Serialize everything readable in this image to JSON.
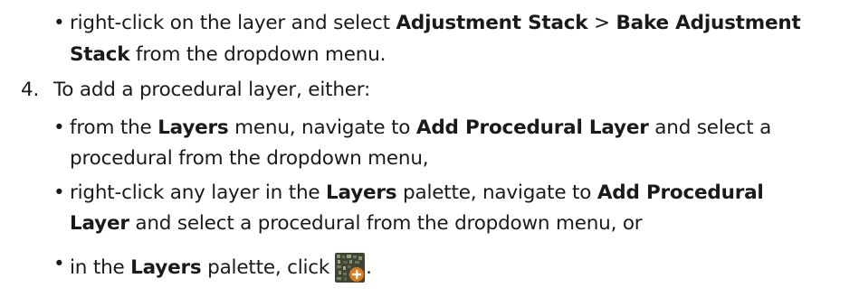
{
  "bullet_glyph": "•",
  "step1": {
    "line1_a": "right-click on the layer and select ",
    "line1_b": "Adjustment Stack",
    "line1_c": " > ",
    "line1_d": "Bake Adjustment",
    "line2_a": "Stack",
    "line2_b": " from the dropdown menu."
  },
  "step4": {
    "number": "4.",
    "text": "To add a procedural layer, either:"
  },
  "bullet1": {
    "line1_a": "from the ",
    "line1_b": "Layers",
    "line1_c": " menu, navigate to ",
    "line1_d": "Add Procedural Layer",
    "line1_e": " and select a",
    "line2": "procedural from the dropdown menu,"
  },
  "bullet2": {
    "line1_a": "right-click any layer in the ",
    "line1_b": "Layers",
    "line1_c": " palette, navigate to ",
    "line1_d": "Add Procedural",
    "line2_a": "Layer",
    "line2_b": " and select a procedural from the dropdown menu, or"
  },
  "bullet3": {
    "text_a": "in the ",
    "text_b": "Layers",
    "text_c": " palette, click",
    "text_d": ".",
    "icon": "add-procedural-layer-icon"
  },
  "colors": {
    "text": "#1a1a1a",
    "icon_bg": "#3c4a36",
    "icon_plus": "#e0701c"
  }
}
